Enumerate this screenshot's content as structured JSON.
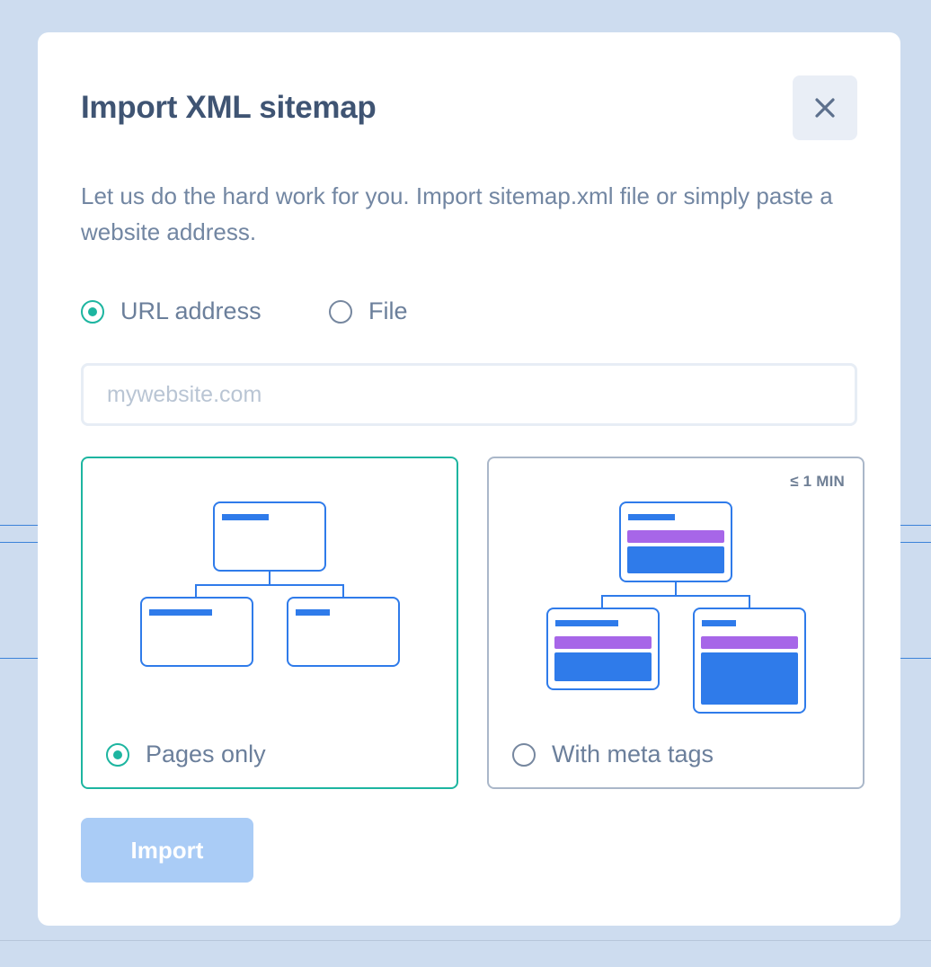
{
  "modal": {
    "title": "Import XML sitemap",
    "description": "Let us do the hard work for you. Import sitemap.xml file or simply paste a website address.",
    "close_icon": "close-icon"
  },
  "source_options": [
    {
      "label": "URL address",
      "selected": true
    },
    {
      "label": "File",
      "selected": false
    }
  ],
  "url_input": {
    "value": "",
    "placeholder": "mywebsite.com"
  },
  "import_cards": [
    {
      "label": "Pages only",
      "selected": true,
      "badge": "",
      "icon": "sitemap-tree-icon"
    },
    {
      "label": "With meta tags",
      "selected": false,
      "badge": "≤ 1 MIN",
      "icon": "sitemap-tree-meta-icon"
    }
  ],
  "import_button": {
    "label": "Import",
    "enabled": false
  },
  "colors": {
    "accent_green": "#1db5a0",
    "primary_blue": "#2f7bea",
    "meta_purple": "#a766e8",
    "disabled_button": "#aaccf6",
    "title_text": "#3f5473",
    "body_text": "#7286a2"
  }
}
